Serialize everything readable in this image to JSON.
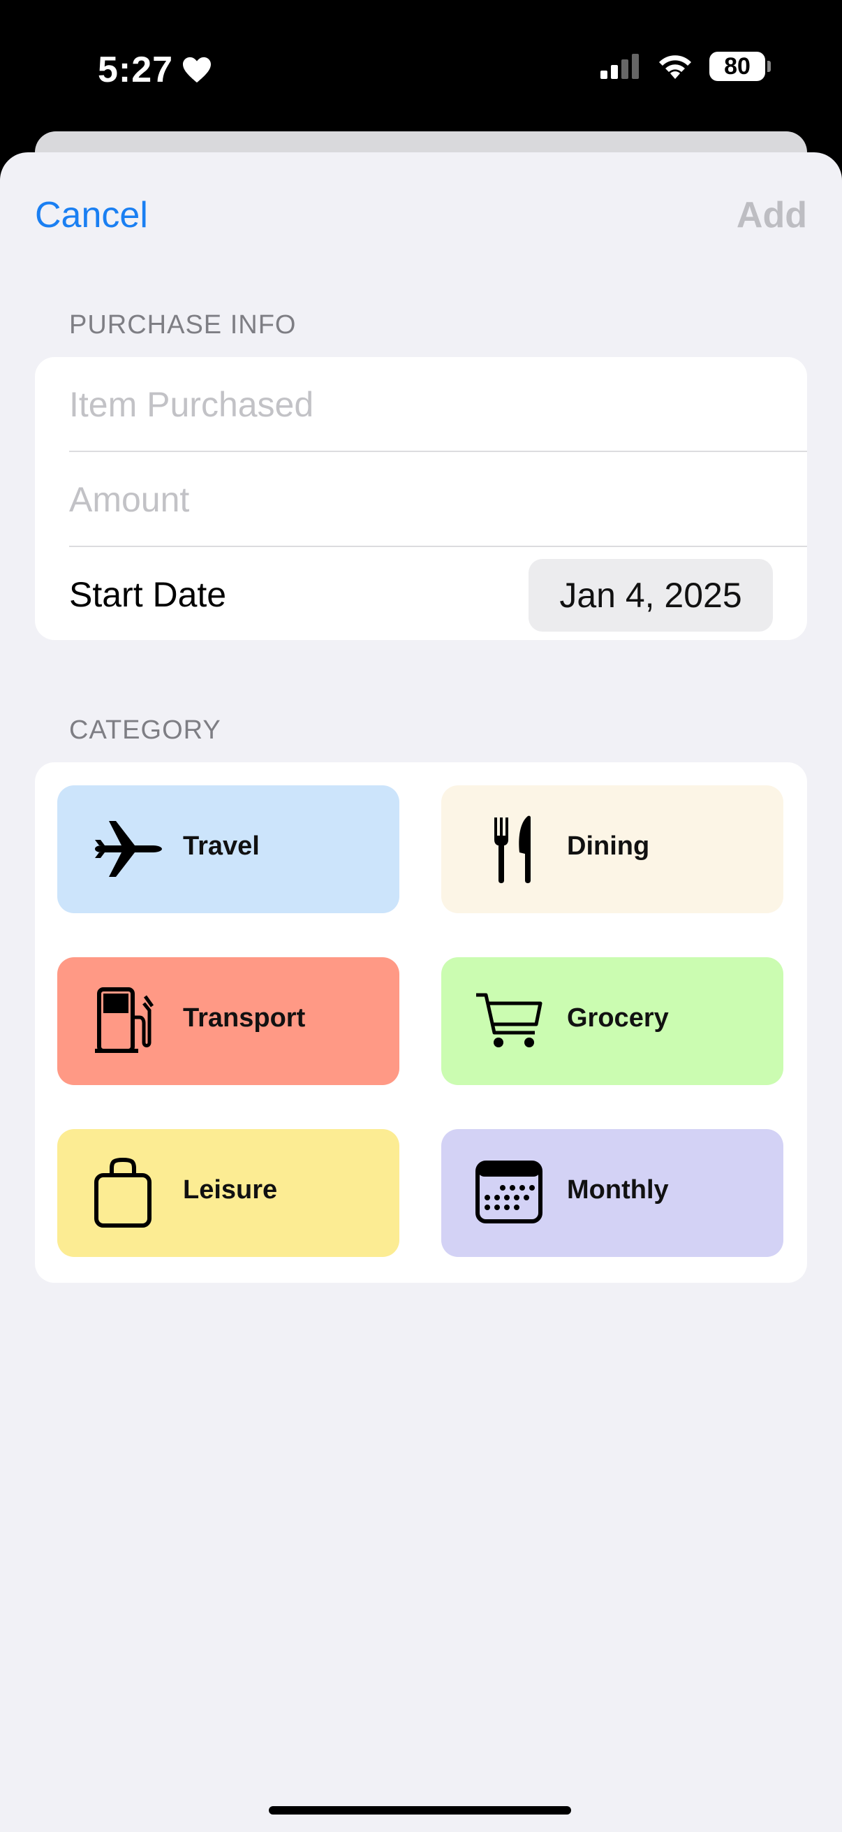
{
  "status_bar": {
    "time": "5:27",
    "battery": "80",
    "icons": [
      "heart-icon",
      "cellular-signal-icon",
      "wifi-icon",
      "battery-icon"
    ]
  },
  "nav": {
    "cancel_label": "Cancel",
    "add_label": "Add"
  },
  "purchase_info": {
    "section_title": "PURCHASE INFO",
    "item_placeholder": "Item Purchased",
    "amount_placeholder": "Amount",
    "start_date_label": "Start Date",
    "start_date_value": "Jan 4, 2025"
  },
  "category": {
    "section_title": "CATEGORY",
    "items": [
      {
        "label": "Travel",
        "icon": "airplane-icon",
        "color": "#cce4fb"
      },
      {
        "label": "Dining",
        "icon": "fork-knife-icon",
        "color": "#fcf5e6"
      },
      {
        "label": "Transport",
        "icon": "fuel-pump-icon",
        "color": "#ff9985"
      },
      {
        "label": "Grocery",
        "icon": "cart-icon",
        "color": "#cbfcb1"
      },
      {
        "label": "Leisure",
        "icon": "bag-icon",
        "color": "#fcec93"
      },
      {
        "label": "Monthly",
        "icon": "calendar-icon",
        "color": "#d3d2f5"
      }
    ]
  },
  "colors": {
    "accent": "#1a7ff2",
    "background": "#f1f1f6"
  }
}
